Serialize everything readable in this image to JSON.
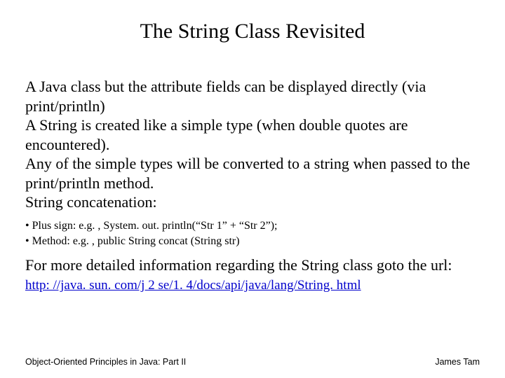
{
  "title": "The String Class Revisited",
  "body": {
    "p1": "A Java class but the attribute fields can be displayed directly (via print/println)",
    "p2": "A String is created like a simple type (when double quotes are encountered).",
    "p3": "Any of the simple types will be converted to a string when passed to the print/println method.",
    "p4": "String concatenation:",
    "sub1": "Plus sign: e.g. , System. out. println(“Str 1” + “Str 2”);",
    "sub2": "Method: e.g. , public String concat (String str)",
    "p5": "For more detailed information regarding the String class goto the url:",
    "link": "http: //java. sun. com/j 2 se/1. 4/docs/api/java/lang/String. html"
  },
  "footer": {
    "left": "Object-Oriented Principles in Java: Part II",
    "right": "James Tam"
  }
}
